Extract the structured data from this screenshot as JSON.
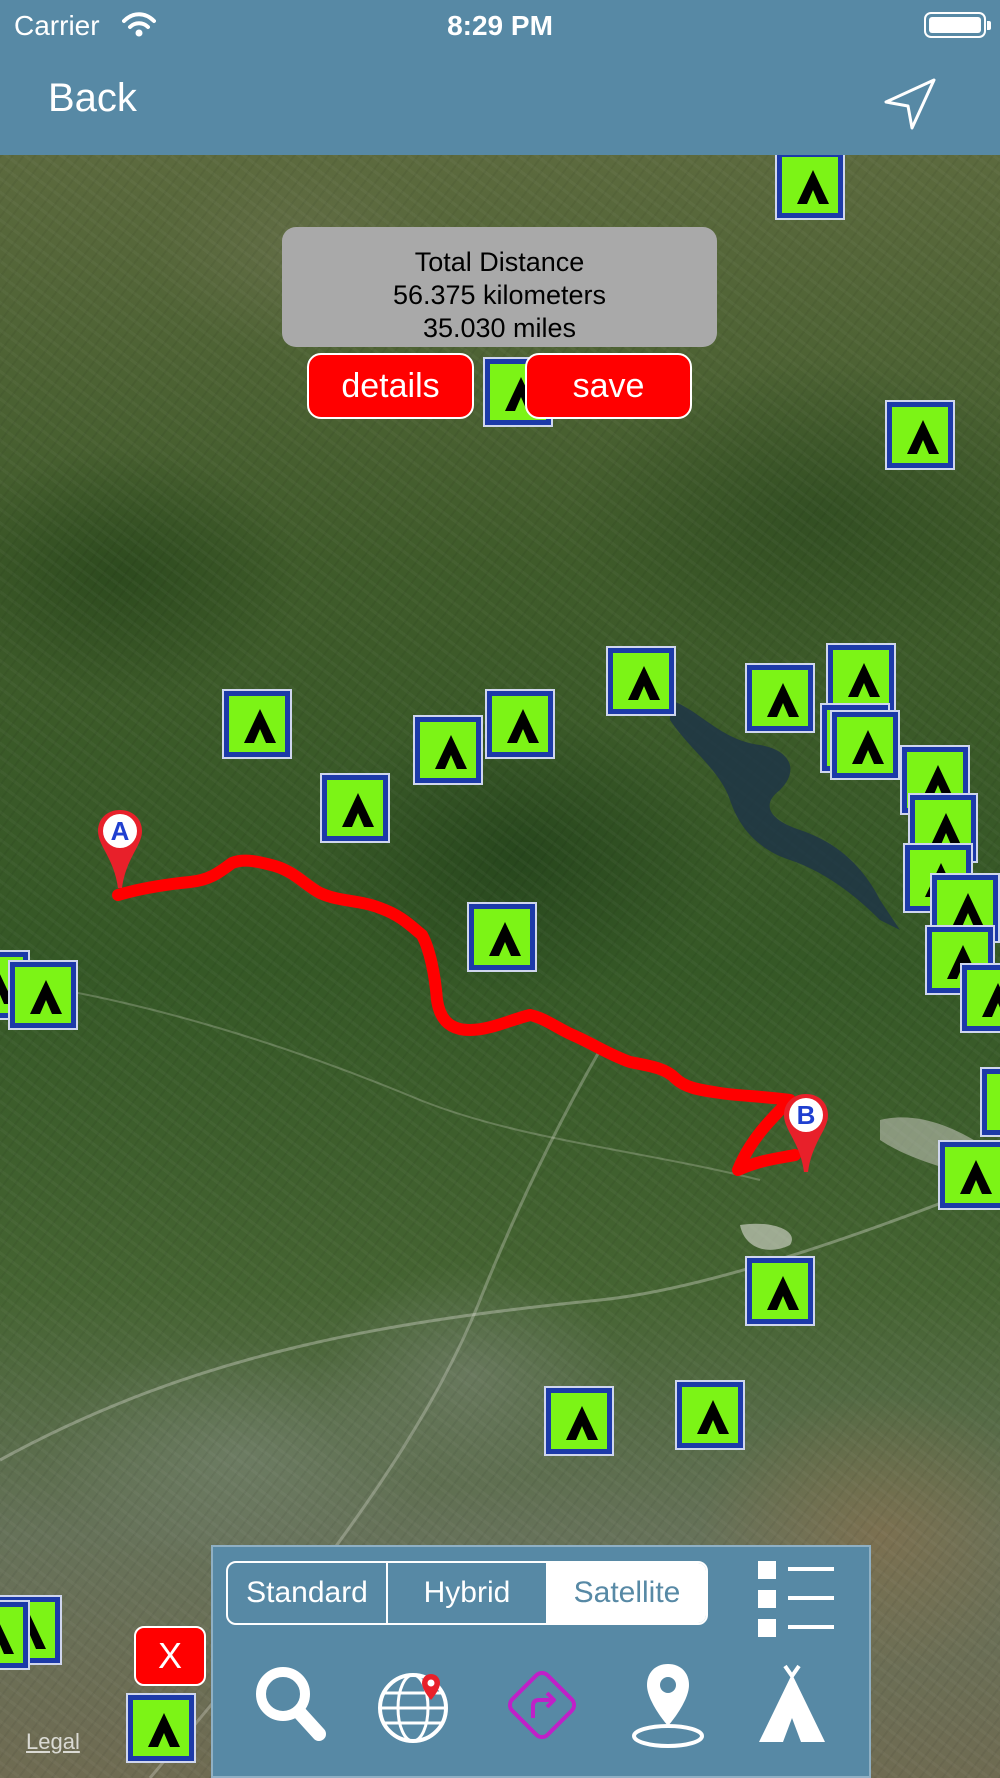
{
  "status_bar": {
    "carrier": "Carrier",
    "time": "8:29 PM"
  },
  "nav": {
    "back_label": "Back"
  },
  "distance": {
    "title": "Total Distance",
    "kilometers": "56.375 kilometers",
    "miles": "35.030 miles"
  },
  "buttons": {
    "details": "details",
    "save": "save",
    "close": "X"
  },
  "route": {
    "start_label": "A",
    "end_label": "B",
    "color": "#ff0000"
  },
  "map_types": {
    "options": [
      "Standard",
      "Hybrid",
      "Satellite"
    ],
    "selected": "Satellite"
  },
  "tools": [
    "search-icon",
    "globe-pin-icon",
    "directions-icon",
    "location-pin-icon",
    "tent-icon"
  ],
  "legal": "Legal",
  "colors": {
    "bar": "#5789a5",
    "accent_red": "#ff0000",
    "marker_blue": "#1c3aa8",
    "marker_green": "#7cf416",
    "directions_purple": "#c020c8"
  }
}
